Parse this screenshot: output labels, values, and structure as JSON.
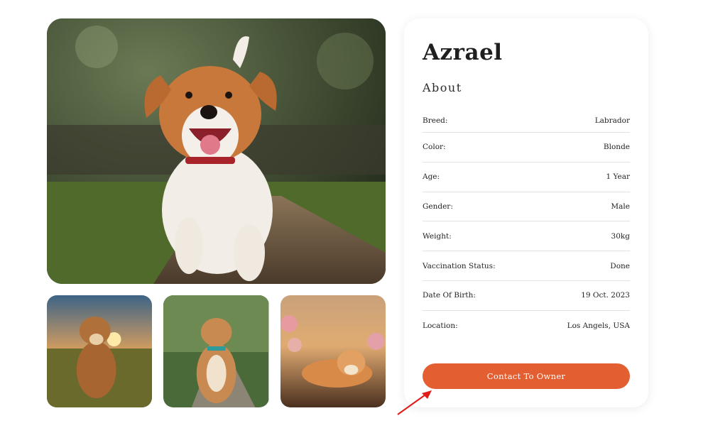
{
  "pet": {
    "name": "Azrael",
    "about_title": "About"
  },
  "details": [
    {
      "label": "Breed:",
      "value": "Labrador"
    },
    {
      "label": "Color:",
      "value": "Blonde"
    },
    {
      "label": "Age:",
      "value": "1 Year"
    },
    {
      "label": "Gender:",
      "value": "Male"
    },
    {
      "label": "Weight:",
      "value": "30kg"
    },
    {
      "label": "Vaccination Status:",
      "value": "Done"
    },
    {
      "label": "Date Of Birth:",
      "value": "19 Oct. 2023"
    },
    {
      "label": "Location:",
      "value": "Los Angels, USA"
    }
  ],
  "actions": {
    "contact_label": "Contact To Owner"
  },
  "colors": {
    "accent": "#e35f32",
    "divider": "#e2e2e2",
    "annotation_arrow": "#e01b1b"
  }
}
